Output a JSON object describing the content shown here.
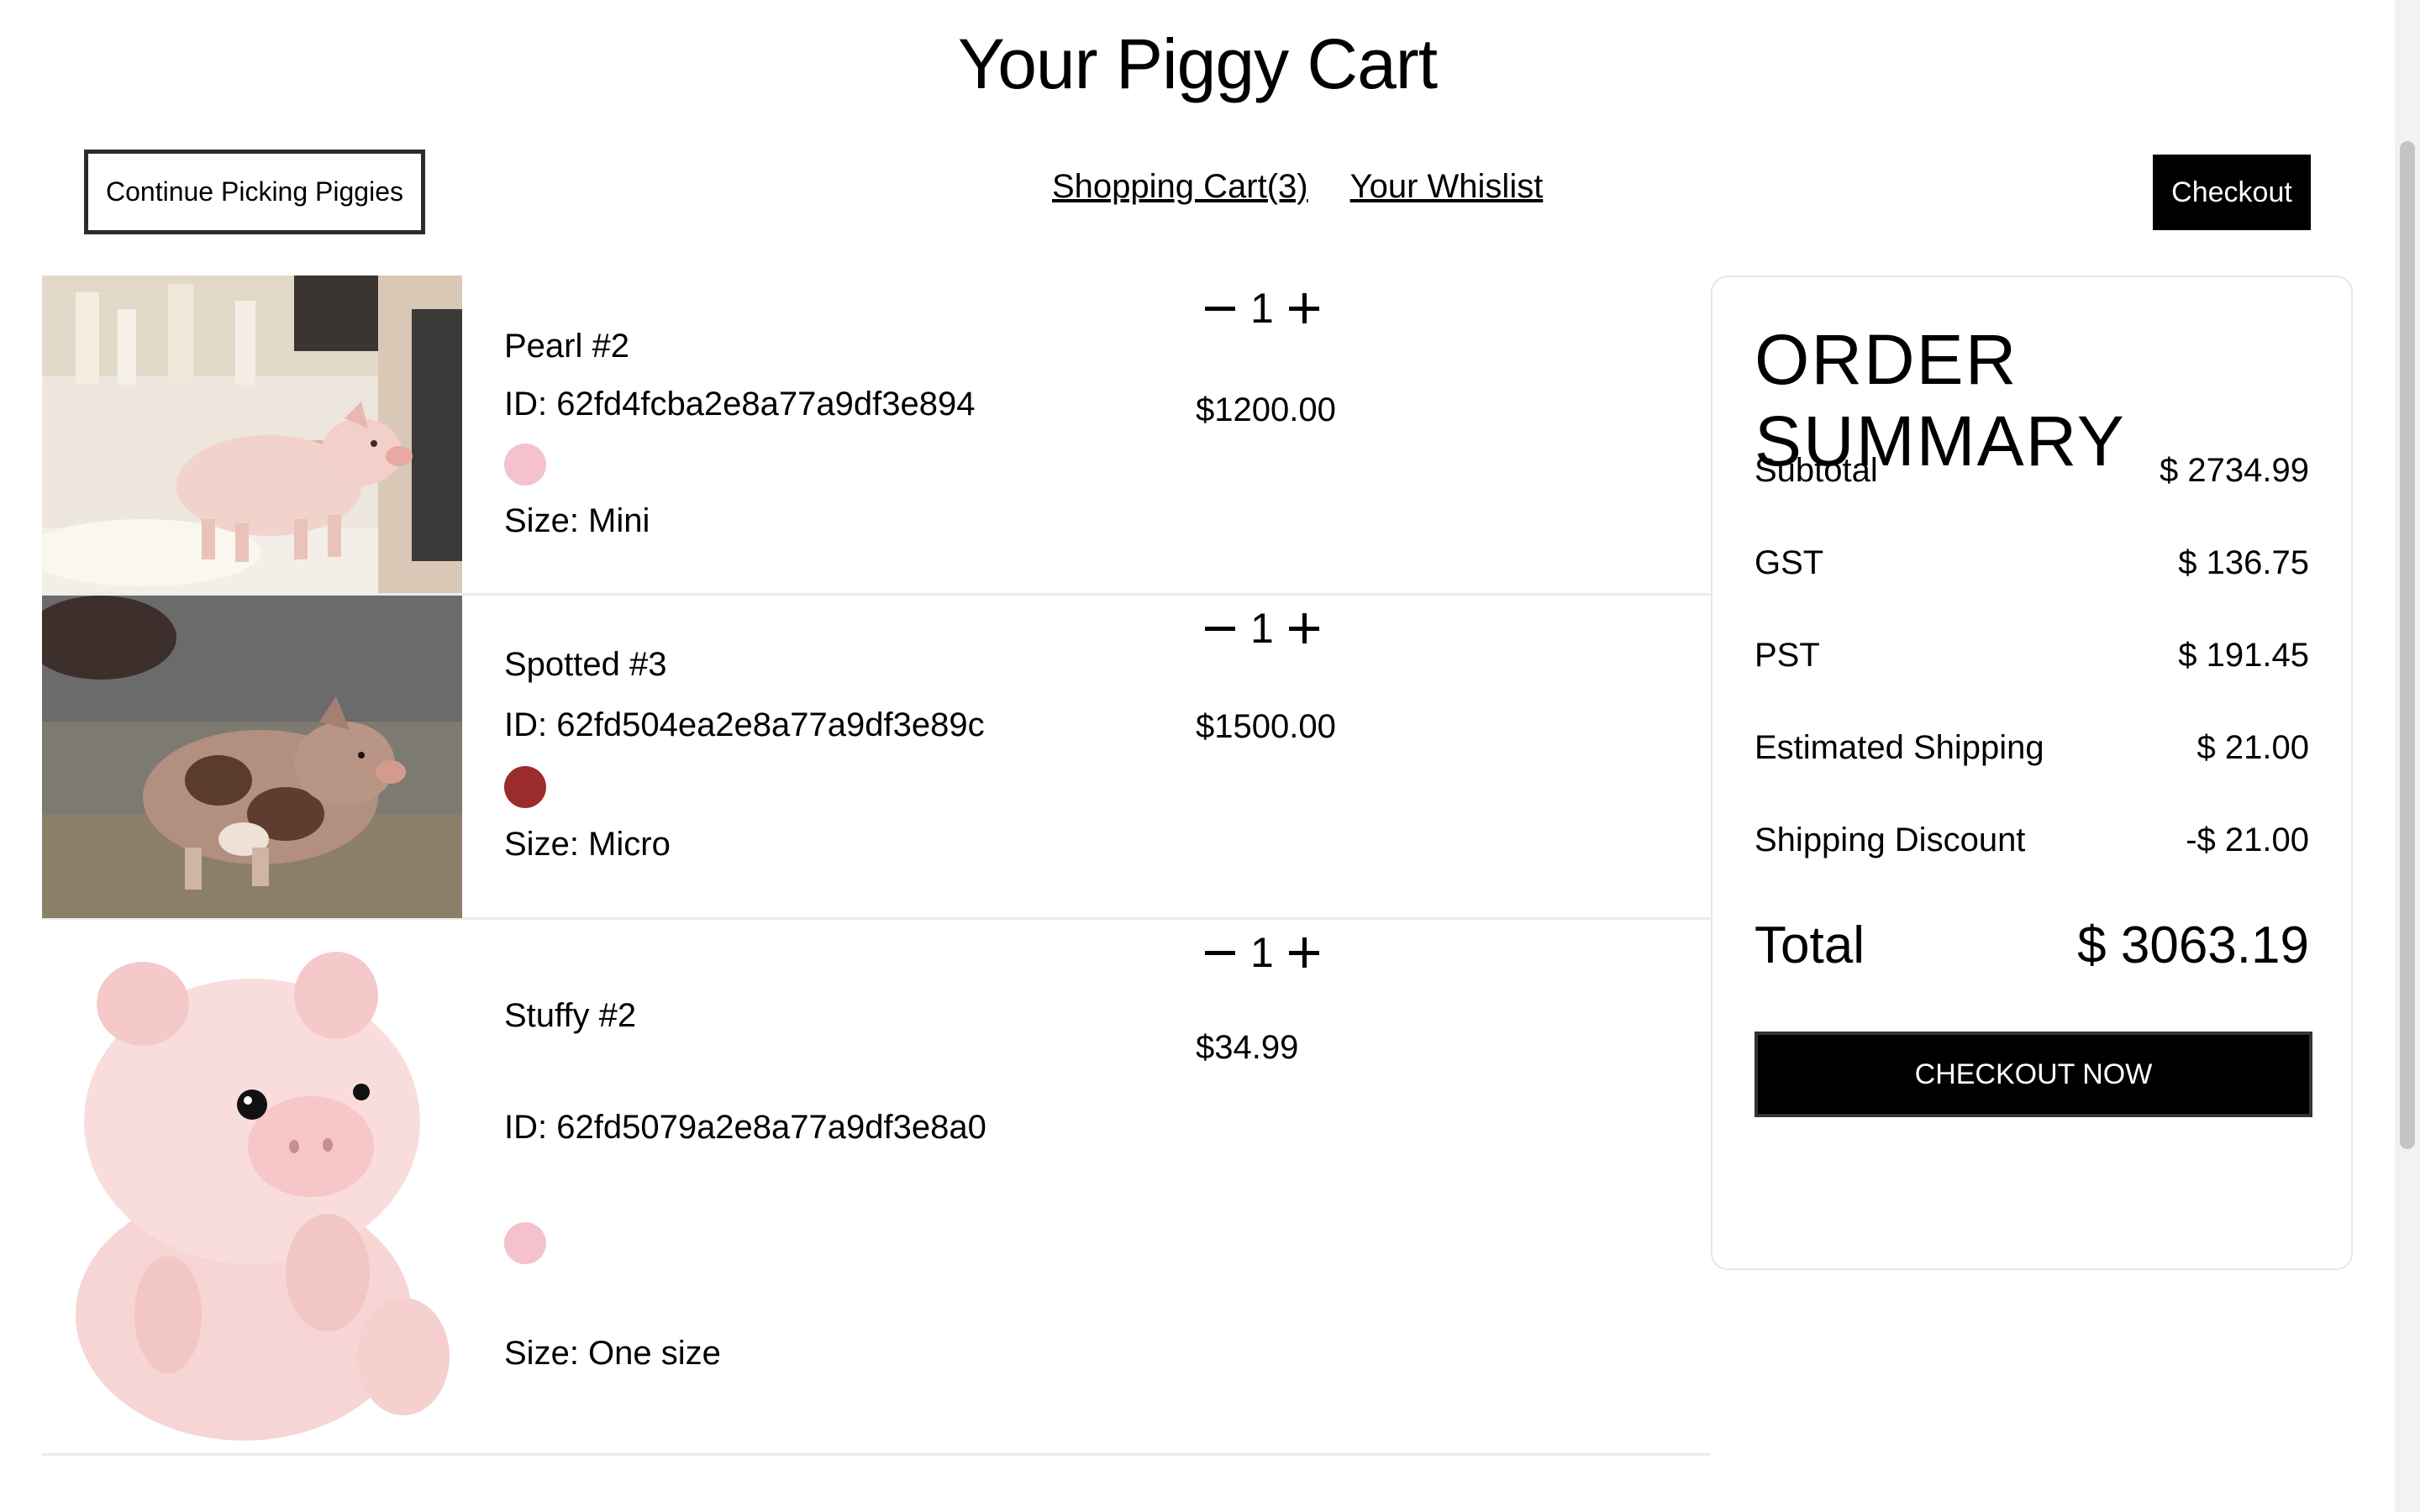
{
  "page": {
    "title": "Your Piggy Cart"
  },
  "header": {
    "continue_label": "Continue Picking Piggies",
    "cart_link": "Shopping Cart(3)",
    "wishlist_link": "Your Whislist",
    "checkout_label": "Checkout"
  },
  "cart": {
    "items": [
      {
        "name": "Pearl #2",
        "id": "ID: 62fd4fcba2e8a77a9df3e894",
        "color": "#f4c2cc",
        "size": "Size: Mini",
        "qty": "1",
        "price": "$1200.00"
      },
      {
        "name": "Spotted #3",
        "id": "ID: 62fd504ea2e8a77a9df3e89c",
        "color": "#9b2c2c",
        "size": "Size: Micro",
        "qty": "1",
        "price": "$1500.00"
      },
      {
        "name": "Stuffy #2",
        "id": "ID: 62fd5079a2e8a77a9df3e8a0",
        "color": "#f4c2cc",
        "size": "Size: One size",
        "qty": "1",
        "price": "$34.99"
      }
    ]
  },
  "summary": {
    "title": "ORDER SUMMARY",
    "rows": [
      {
        "label": "Subtotal",
        "value": "$ 2734.99"
      },
      {
        "label": "GST",
        "value": "$ 136.75"
      },
      {
        "label": "PST",
        "value": "$ 191.45"
      },
      {
        "label": "Estimated Shipping",
        "value": "$ 21.00"
      },
      {
        "label": "Shipping Discount",
        "value": "-$ 21.00"
      }
    ],
    "total_label": "Total",
    "total_value": "$ 3063.19",
    "checkout_now_label": "CHECKOUT NOW"
  }
}
